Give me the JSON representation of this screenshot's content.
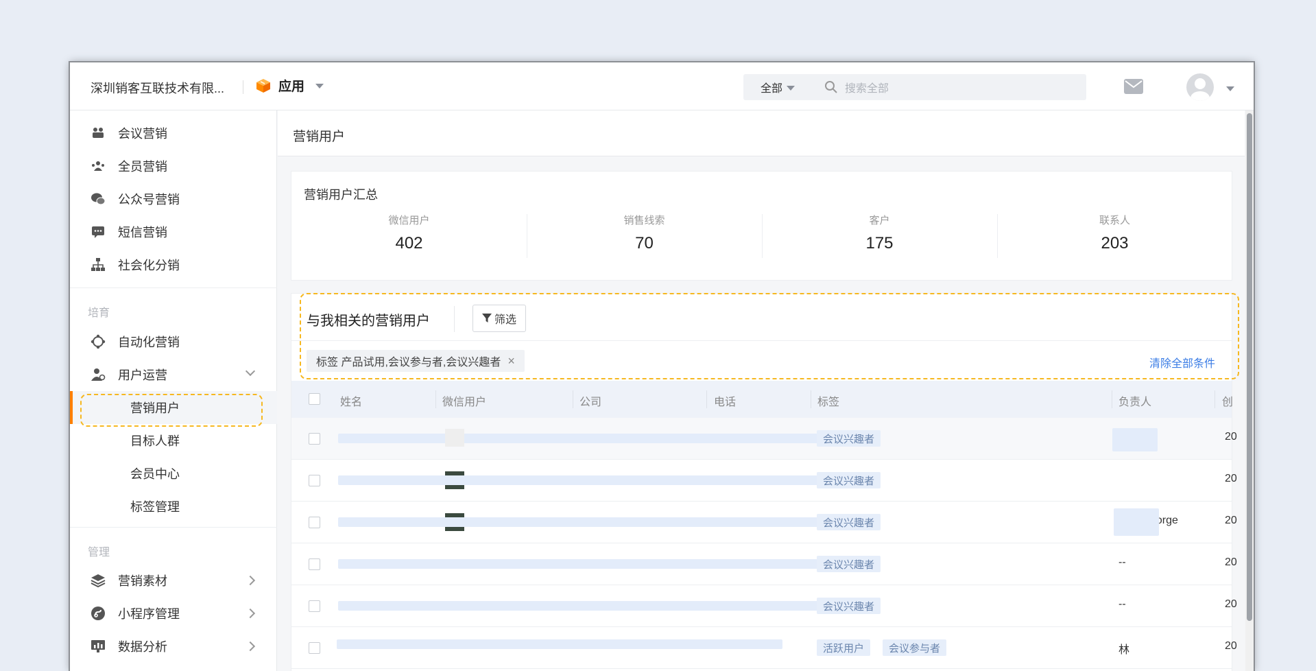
{
  "topbar": {
    "company": "深圳销客互联技术有限...",
    "app_label": "应用",
    "search_scope": "全部",
    "search_placeholder": "搜索全部"
  },
  "sidebar": {
    "items_top": [
      {
        "label": "会议营销",
        "icon": "meeting-icon"
      },
      {
        "label": "全员营销",
        "icon": "team-icon"
      },
      {
        "label": "公众号营销",
        "icon": "wechat-icon"
      },
      {
        "label": "短信营销",
        "icon": "sms-icon"
      },
      {
        "label": "社会化分销",
        "icon": "org-tree-icon"
      }
    ],
    "section_nurture": "培育",
    "items_nurture": [
      {
        "label": "自动化营销",
        "icon": "automation-icon"
      },
      {
        "label": "用户运营",
        "icon": "user-ops-icon"
      }
    ],
    "subitems": [
      "营销用户",
      "目标人群",
      "会员中心",
      "标签管理"
    ],
    "section_manage": "管理",
    "items_manage": [
      {
        "label": "营销素材",
        "icon": "layers-icon"
      },
      {
        "label": "小程序管理",
        "icon": "miniprogram-icon"
      },
      {
        "label": "数据分析",
        "icon": "chart-icon"
      }
    ]
  },
  "main": {
    "page_title": "营销用户",
    "summary_title": "营销用户汇总",
    "stats": [
      {
        "label": "微信用户",
        "value": "402"
      },
      {
        "label": "销售线索",
        "value": "70"
      },
      {
        "label": "客户",
        "value": "175"
      },
      {
        "label": "联系人",
        "value": "203"
      }
    ],
    "list_title": "与我相关的营销用户",
    "filter_label": "筛选",
    "filter_chip": "标签 产品试用,会议参与者,会议兴趣者",
    "clear_all": "清除全部条件",
    "columns": [
      "姓名",
      "微信用户",
      "公司",
      "电话",
      "标签",
      "负责人",
      "创"
    ],
    "rows": [
      {
        "tags": [
          "会议兴趣者"
        ],
        "owner": "",
        "date": "20"
      },
      {
        "tags": [
          "会议兴趣者"
        ],
        "owner": "",
        "date": "20"
      },
      {
        "tags": [
          "会议兴趣者"
        ],
        "owner": "eorge",
        "date": "20"
      },
      {
        "tags": [
          "会议兴趣者"
        ],
        "owner": "--",
        "date": "20"
      },
      {
        "tags": [
          "会议兴趣者"
        ],
        "owner": "--",
        "date": "20"
      },
      {
        "tags": [
          "活跃用户",
          "会议参与者"
        ],
        "owner": "林",
        "date": "20"
      }
    ]
  },
  "colors": {
    "accent": "#ff8000",
    "highlight_dash": "#f6b820",
    "link": "#3a7ce5",
    "tag_bg": "#e6eefa"
  }
}
